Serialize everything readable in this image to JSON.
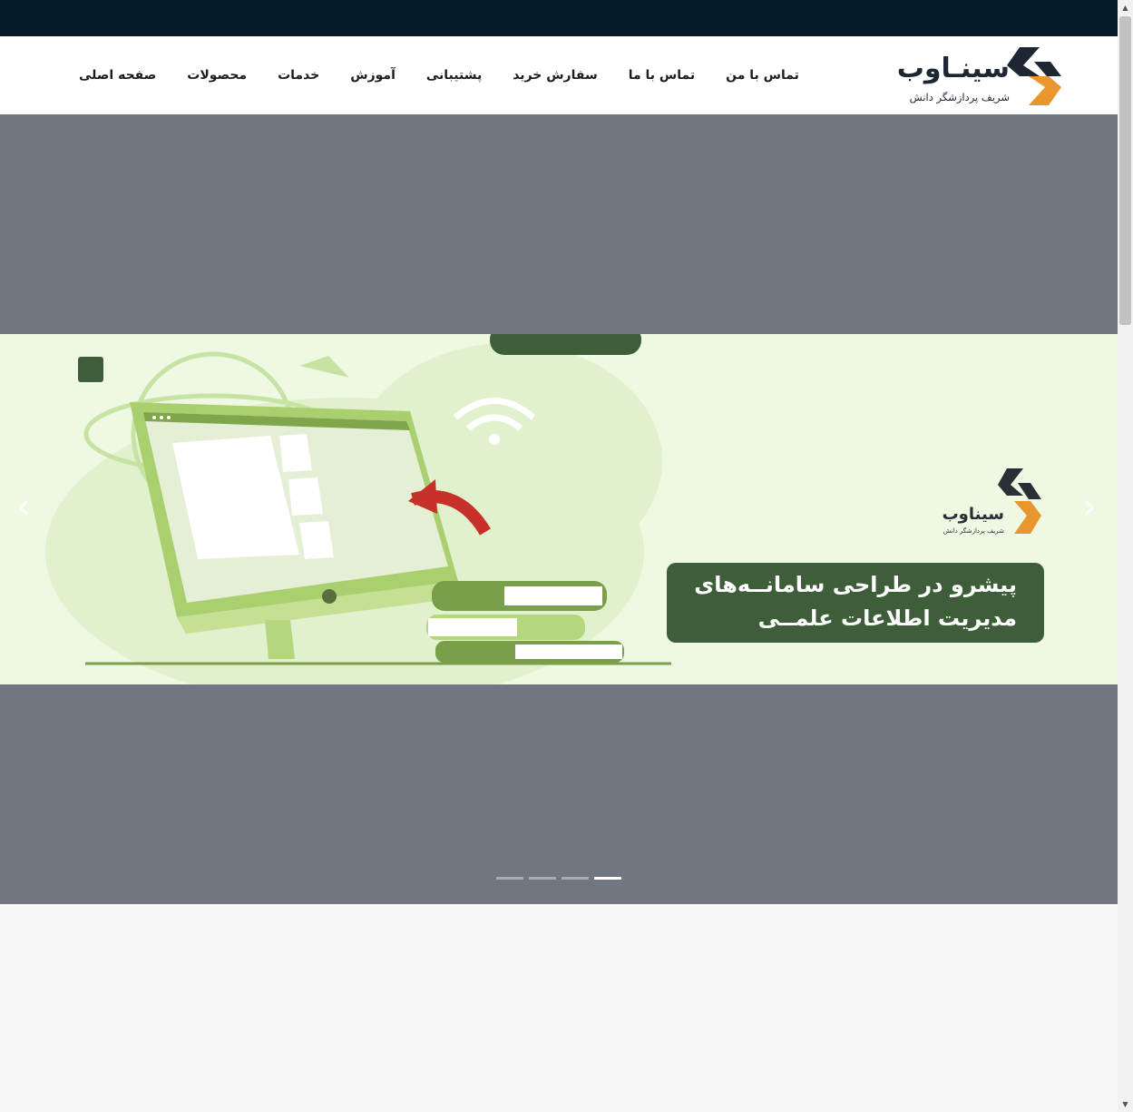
{
  "brand": {
    "name": "سینـاوب",
    "tagline": "شریف پردازشگر دانش"
  },
  "nav": {
    "items": [
      {
        "label": "صفحه اصلی"
      },
      {
        "label": "محصولات"
      },
      {
        "label": "خدمات"
      },
      {
        "label": "آموزش"
      },
      {
        "label": "پشتیبانی"
      },
      {
        "label": "سفارش خرید"
      },
      {
        "label": "تماس با ما"
      },
      {
        "label": "تماس با من"
      }
    ]
  },
  "slider": {
    "logo_name": "سیناوب",
    "logo_tagline": "شریف پردازشگر دانش",
    "caption_line1": "پیشرو در طراحی سامانــه‌های",
    "caption_line2": "مدیریت اطلاعات علمــی",
    "prev_icon": "chevron-left-icon",
    "next_icon": "chevron-right-icon",
    "slide_count": 4,
    "active_slide": 4
  },
  "colors": {
    "topbar": "#071c2b",
    "hero_bg": "#717780",
    "slide_bg": "#eef8e2",
    "caption_bg": "#3d5e39",
    "logo_dark": "#1c2733",
    "logo_orange": "#e9962f"
  }
}
